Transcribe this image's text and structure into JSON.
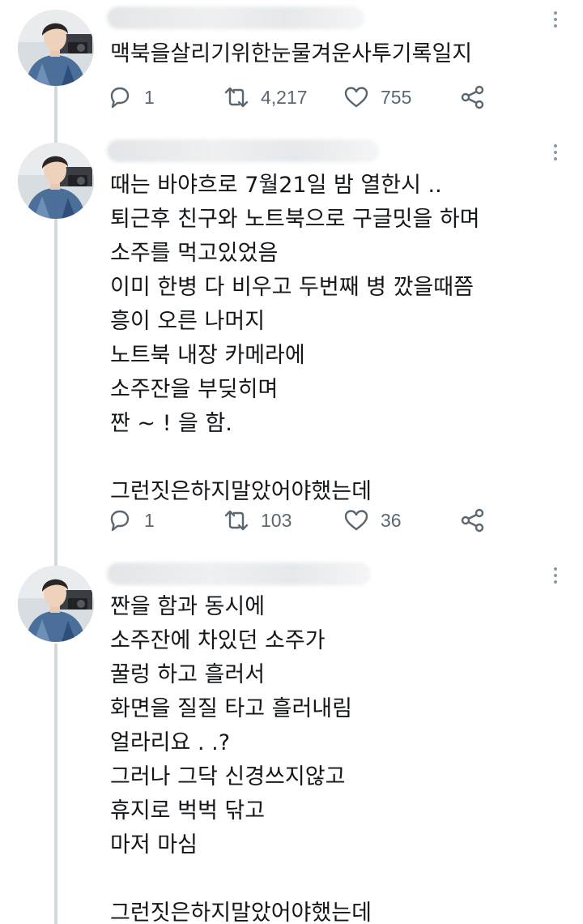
{
  "tweets": [
    {
      "lines": [
        "맥북을살리기위한눈물겨운사투기록일지"
      ],
      "replies": "1",
      "retweets": "4,217",
      "likes": "755"
    },
    {
      "lines": [
        "때는 바야흐로 7월21일 밤 열한시 ..",
        "퇴근후 친구와 노트북으로 구글밋을 하며",
        "소주를 먹고있었음",
        "이미 한병 다 비우고 두번째 병 깠을때쯤",
        "흥이 오른 나머지",
        "노트북 내장 카메라에",
        "소주잔을 부딪히며",
        "짠 ~ ! 을 함.",
        "",
        "그런짓은하지말았어야했는데"
      ],
      "replies": "1",
      "retweets": "103",
      "likes": "36"
    },
    {
      "lines": [
        "짠을 함과 동시에",
        "소주잔에 차있던 소주가",
        "꿀렁 하고 흘러서",
        "화면을 질질 타고 흘러내림",
        "얼라리요 . .?",
        "그러나 그닥 신경쓰지않고",
        "휴지로 벅벅 닦고",
        "마저 마심",
        "",
        "그런짓은하지말았어야했는데"
      ]
    }
  ],
  "colors": {
    "text": "#14171a",
    "icon": "#5b6770",
    "thread_line": "#cfd9de"
  },
  "icons": {
    "reply": "reply-icon",
    "retweet": "retweet-icon",
    "like": "heart-icon",
    "share": "share-icon",
    "more": "more-options-icon"
  }
}
